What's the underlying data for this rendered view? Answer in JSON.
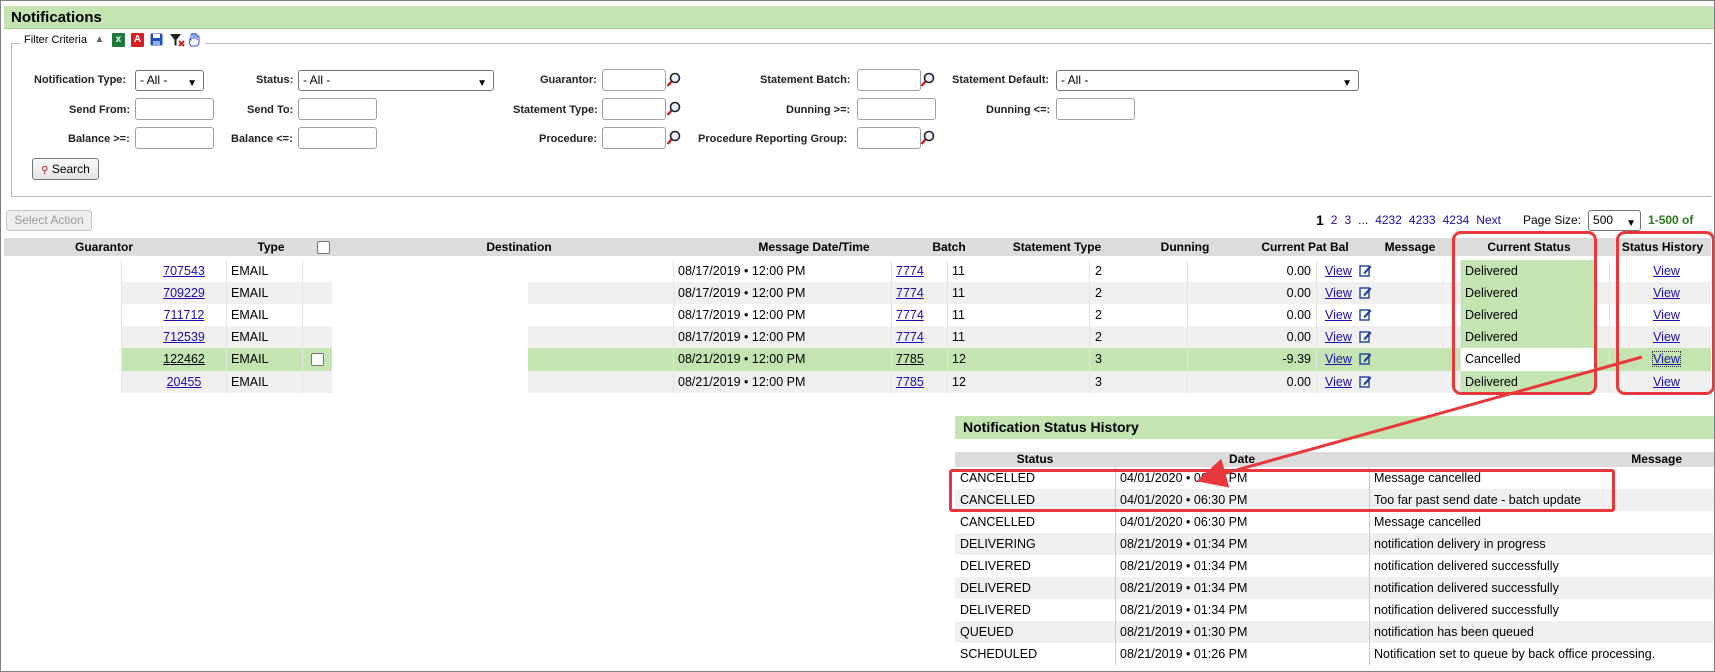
{
  "page": {
    "title": "Notifications"
  },
  "colors": {
    "header_green": "#c4e4b2",
    "highlight_red": "#e8383b",
    "link_blue": "#1a0dab"
  },
  "filter": {
    "legend": "Filter Criteria",
    "icons": [
      "collapse-arrow-icon",
      "excel-export-icon",
      "pdf-export-icon",
      "save-icon",
      "clear-filter-icon",
      "hand-icon"
    ],
    "notification_type_label": "Notification Type:",
    "notification_type_value": "- All -",
    "status_label": "Status:",
    "status_value": "- All -",
    "guarantor_label": "Guarantor:",
    "statement_batch_label": "Statement Batch:",
    "statement_default_label": "Statement Default:",
    "statement_default_value": "- All -",
    "send_from_label": "Send From:",
    "send_to_label": "Send To:",
    "statement_type_label": "Statement Type:",
    "dunning_gte_label": "Dunning >=:",
    "dunning_lte_label": "Dunning <=:",
    "balance_gte_label": "Balance >=:",
    "balance_lte_label": "Balance <=:",
    "procedure_label": "Procedure:",
    "procedure_group_label": "Procedure Reporting Group:",
    "search_button": "Search"
  },
  "actions": {
    "select_action": "Select Action"
  },
  "pager": {
    "current": "1",
    "p2": "2",
    "p3": "3",
    "ellipsis": "...",
    "p4232": "4232",
    "p4233": "4233",
    "p4234": "4234",
    "next": "Next",
    "page_size_label": "Page Size:",
    "page_size": "500",
    "range": "1-500 of"
  },
  "table": {
    "columns": {
      "guarantor": "Guarantor",
      "type": "Type",
      "destination": "Destination",
      "message_datetime": "Message Date/Time",
      "batch": "Batch",
      "statement_type": "Statement Type",
      "dunning": "Dunning",
      "current_pat_bal": "Current Pat Bal",
      "message": "Message",
      "current_status": "Current Status",
      "status_history": "Status History"
    },
    "rows": [
      {
        "guarantor": "707543",
        "type": "EMAIL",
        "datetime": "08/17/2019 • 12:00 PM",
        "batch": "7774",
        "statement_type": "11",
        "dunning": "2",
        "balance": "0.00",
        "message": "View",
        "current_status": "Delivered",
        "history": "View"
      },
      {
        "guarantor": "709229",
        "type": "EMAIL",
        "datetime": "08/17/2019 • 12:00 PM",
        "batch": "7774",
        "statement_type": "11",
        "dunning": "2",
        "balance": "0.00",
        "message": "View",
        "current_status": "Delivered",
        "history": "View"
      },
      {
        "guarantor": "711712",
        "type": "EMAIL",
        "datetime": "08/17/2019 • 12:00 PM",
        "batch": "7774",
        "statement_type": "11",
        "dunning": "2",
        "balance": "0.00",
        "message": "View",
        "current_status": "Delivered",
        "history": "View"
      },
      {
        "guarantor": "712539",
        "type": "EMAIL",
        "datetime": "08/17/2019 • 12:00 PM",
        "batch": "7774",
        "statement_type": "11",
        "dunning": "2",
        "balance": "0.00",
        "message": "View",
        "current_status": "Delivered",
        "history": "View"
      },
      {
        "guarantor": "122462",
        "type": "EMAIL",
        "datetime": "08/21/2019 • 12:00 PM",
        "batch": "7785",
        "statement_type": "12",
        "dunning": "3",
        "balance": "-9.39",
        "message": "View",
        "current_status": "Cancelled",
        "history": "View"
      },
      {
        "guarantor": "20455",
        "type": "EMAIL",
        "datetime": "08/21/2019 • 12:00 PM",
        "batch": "7785",
        "statement_type": "12",
        "dunning": "3",
        "balance": "0.00",
        "message": "View",
        "current_status": "Delivered",
        "history": "View"
      }
    ]
  },
  "history": {
    "title": "Notification Status History",
    "columns": {
      "status": "Status",
      "date": "Date",
      "message": "Message"
    },
    "rows": [
      {
        "status": "CANCELLED",
        "date": "04/01/2020 • 06:30 PM",
        "message": "Message cancelled"
      },
      {
        "status": "CANCELLED",
        "date": "04/01/2020 • 06:30 PM",
        "message": "Too far past send date - batch update"
      },
      {
        "status": "CANCELLED",
        "date": "04/01/2020 • 06:30 PM",
        "message": "Message cancelled"
      },
      {
        "status": "DELIVERING",
        "date": "08/21/2019 • 01:34 PM",
        "message": "notification delivery in progress"
      },
      {
        "status": "DELIVERED",
        "date": "08/21/2019 • 01:34 PM",
        "message": "notification delivered successfully"
      },
      {
        "status": "DELIVERED",
        "date": "08/21/2019 • 01:34 PM",
        "message": "notification delivered successfully"
      },
      {
        "status": "DELIVERED",
        "date": "08/21/2019 • 01:34 PM",
        "message": "notification delivered successfully"
      },
      {
        "status": "QUEUED",
        "date": "08/21/2019 • 01:30 PM",
        "message": "notification has been queued"
      },
      {
        "status": "SCHEDULED",
        "date": "08/21/2019 • 01:26 PM",
        "message": "Notification set to queue by back office processing."
      }
    ]
  }
}
